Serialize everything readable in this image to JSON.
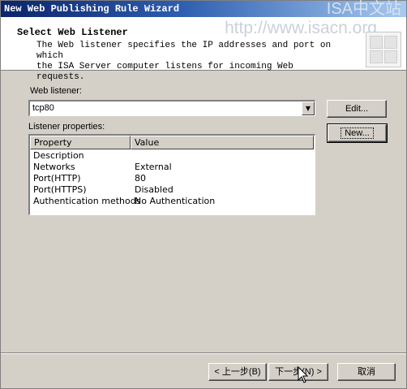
{
  "window": {
    "title": "New Web Publishing Rule Wizard",
    "watermark_logo": "ISA中文站"
  },
  "header": {
    "title": "Select Web Listener",
    "description_line1": "The Web listener specifies the IP addresses and port on which",
    "description_line2": "the ISA Server computer listens for incoming Web requests.",
    "watermark_url": "http://www.isacn.org"
  },
  "listener": {
    "label": "Web listener:",
    "selected": "tcp80",
    "edit_button": "Edit...",
    "new_button": "New..."
  },
  "properties": {
    "label": "Listener properties:",
    "columns": [
      "Property",
      "Value"
    ],
    "rows": [
      [
        "Description",
        ""
      ],
      [
        "Networks",
        "External"
      ],
      [
        "Port(HTTP)",
        "80"
      ],
      [
        "Port(HTTPS)",
        "Disabled"
      ],
      [
        "Authentication methods",
        "No Authentication"
      ]
    ]
  },
  "footer": {
    "back_button": "< 上一步(B)",
    "next_button": "下一步(N) >",
    "cancel_button": "取消"
  }
}
